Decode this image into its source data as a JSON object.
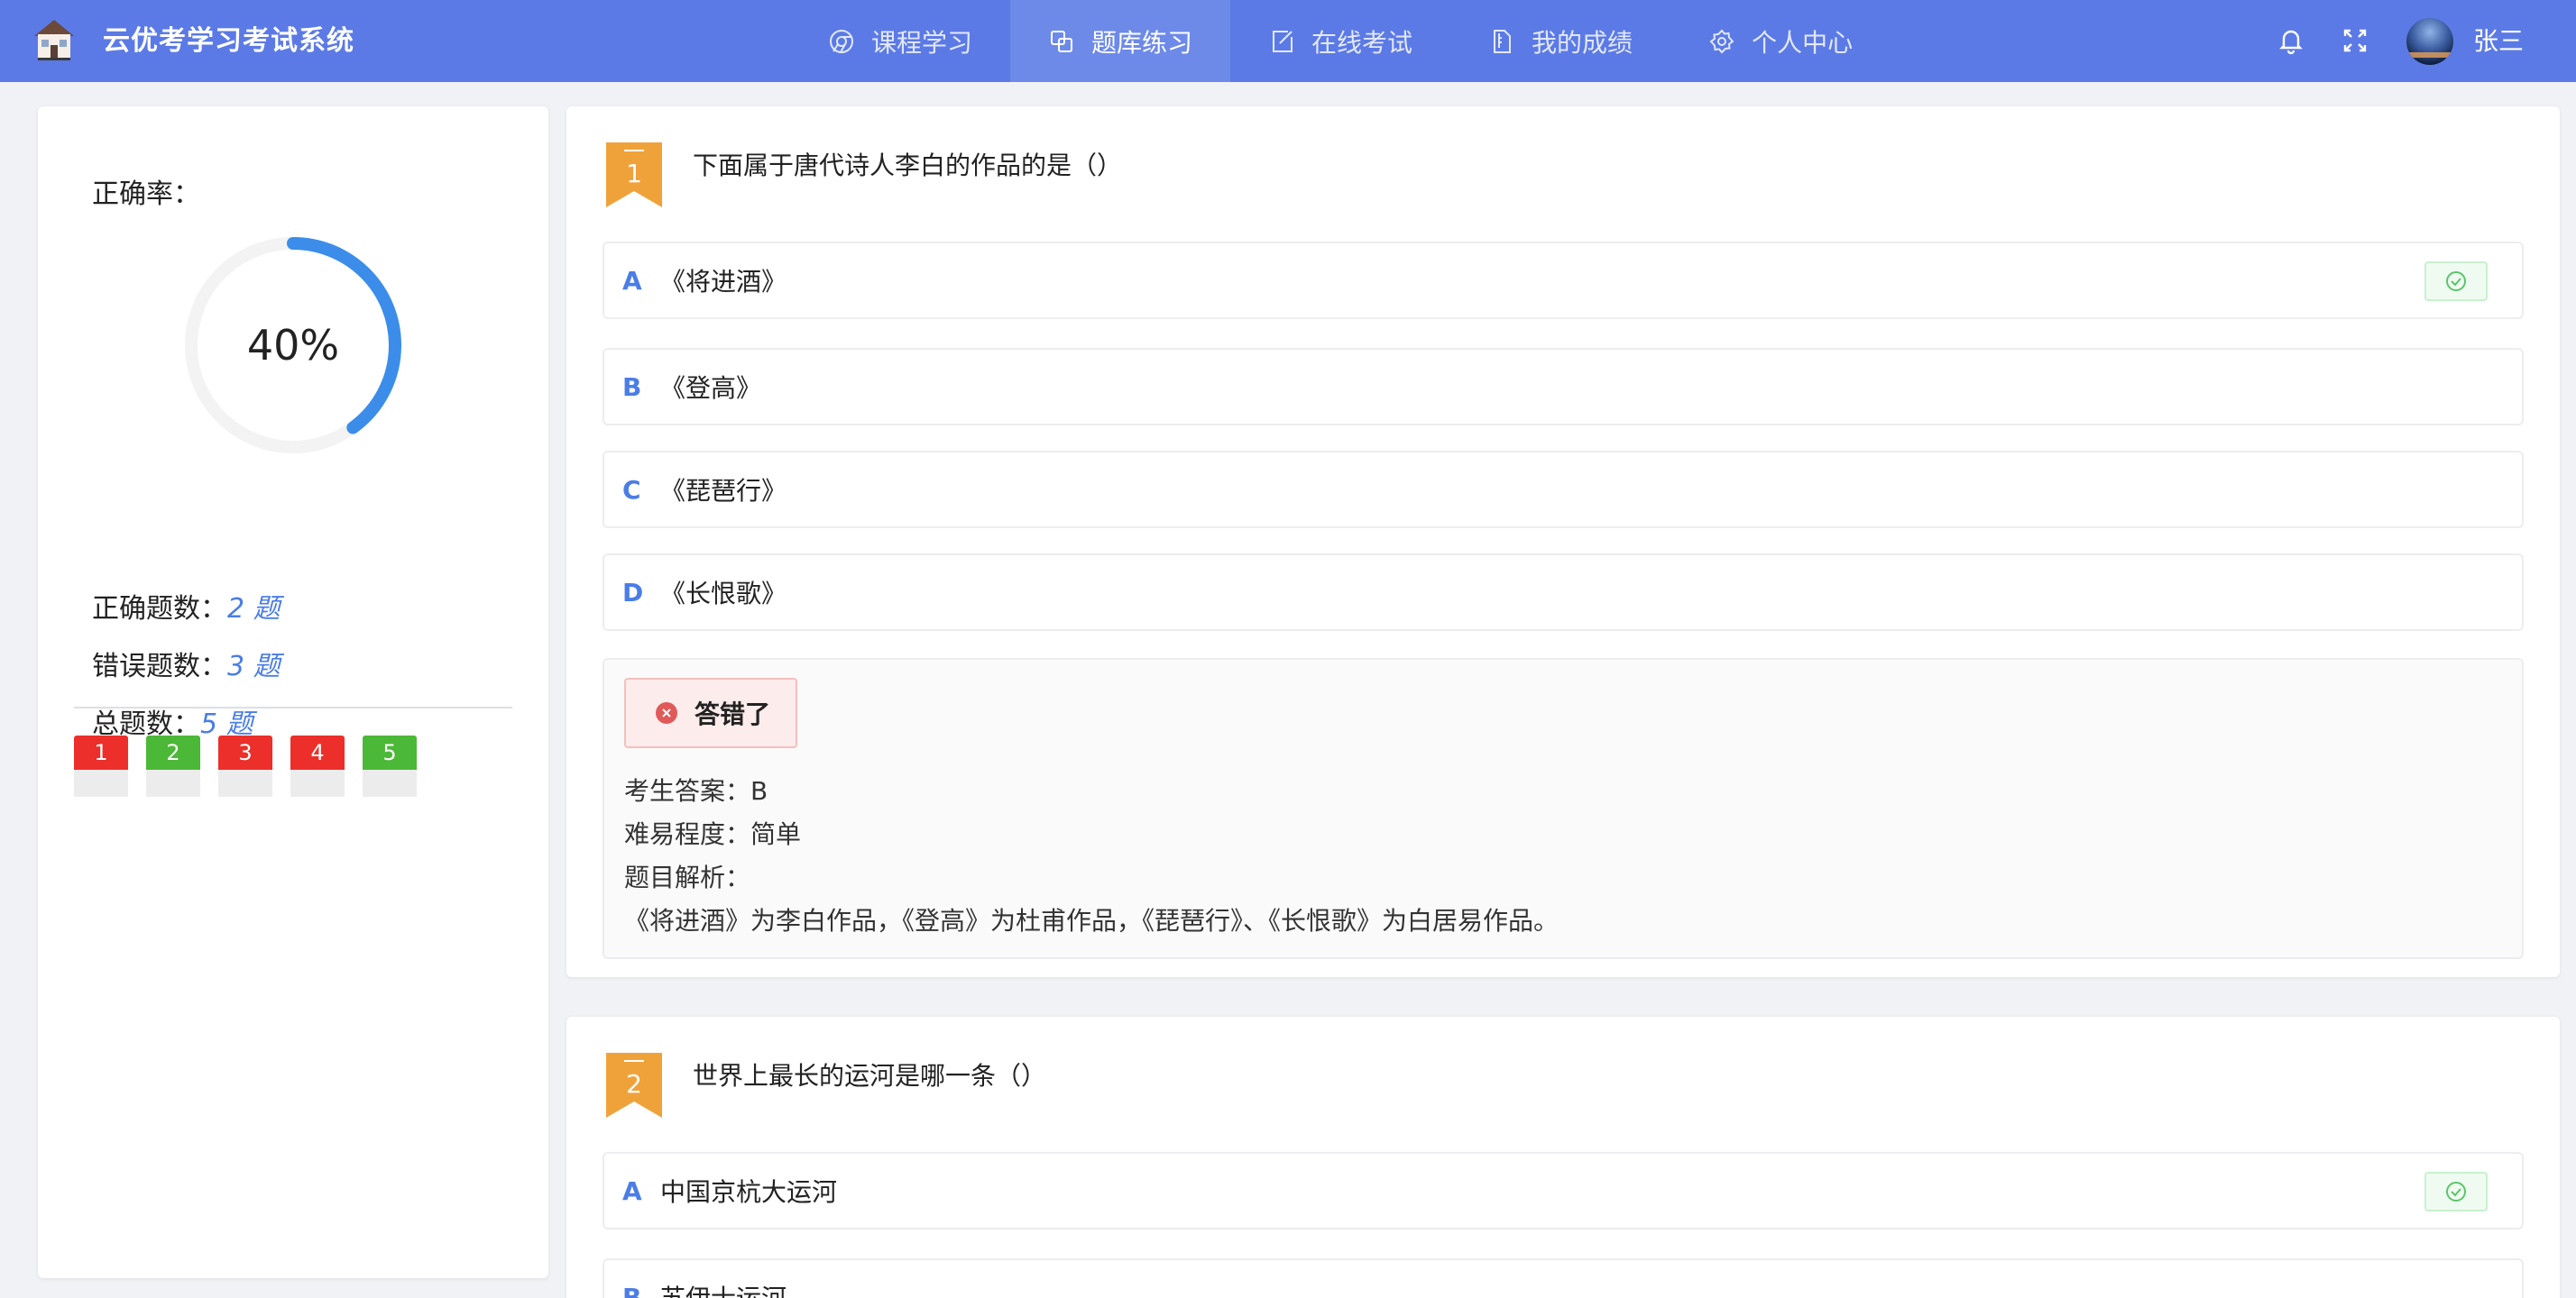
{
  "header": {
    "app_title": "云优考学习考试系统",
    "nav": [
      {
        "label": "课程学习",
        "icon": "chrome-circle-icon",
        "active": false
      },
      {
        "label": "题库练习",
        "icon": "copy-squares-icon",
        "active": true
      },
      {
        "label": "在线考试",
        "icon": "edit-square-icon",
        "active": false
      },
      {
        "label": "我的成绩",
        "icon": "document-icon",
        "active": false
      },
      {
        "label": "个人中心",
        "icon": "gear-icon",
        "active": false
      }
    ],
    "username": "张三"
  },
  "sidebar": {
    "accuracy_label": "正确率：",
    "accuracy_value": "40%",
    "accuracy_fraction": 0.4,
    "stats": [
      {
        "label": "正确题数：",
        "value": "2 题"
      },
      {
        "label": "错误题数：",
        "value": "3 题"
      },
      {
        "label": "总题数：",
        "value": "5 题"
      }
    ],
    "questions": [
      {
        "num": "1",
        "status": "wrong"
      },
      {
        "num": "2",
        "status": "right"
      },
      {
        "num": "3",
        "status": "wrong"
      },
      {
        "num": "4",
        "status": "wrong"
      },
      {
        "num": "5",
        "status": "right"
      }
    ]
  },
  "questions": [
    {
      "badge": "1",
      "text": "下面属于唐代诗人李白的作品的是（）",
      "options": [
        {
          "letter": "A",
          "text": "《将进酒》",
          "correct": true
        },
        {
          "letter": "B",
          "text": "《登高》",
          "correct": false
        },
        {
          "letter": "C",
          "text": "《琵琶行》",
          "correct": false
        },
        {
          "letter": "D",
          "text": "《长恨歌》",
          "correct": false
        }
      ],
      "result": {
        "status": "答错了",
        "student_answer": "考生答案：B",
        "difficulty": "难易程度：简单",
        "analysis_label": "题目解析：",
        "analysis": "《将进酒》为李白作品，《登高》为杜甫作品，《琵琶行》、《长恨歌》为白居易作品。"
      }
    },
    {
      "badge": "2",
      "text": "世界上最长的运河是哪一条（）",
      "options": [
        {
          "letter": "A",
          "text": "中国京杭大运河",
          "correct": true
        },
        {
          "letter": "B",
          "text": "苏伊士运河",
          "correct": false
        }
      ]
    }
  ],
  "colors": {
    "header_bg": "#5b7ae6",
    "accent_blue": "#4a7de6",
    "wrong_red": "#ec2f2a",
    "right_green": "#4cb837",
    "badge_orange": "#f0a23a"
  }
}
